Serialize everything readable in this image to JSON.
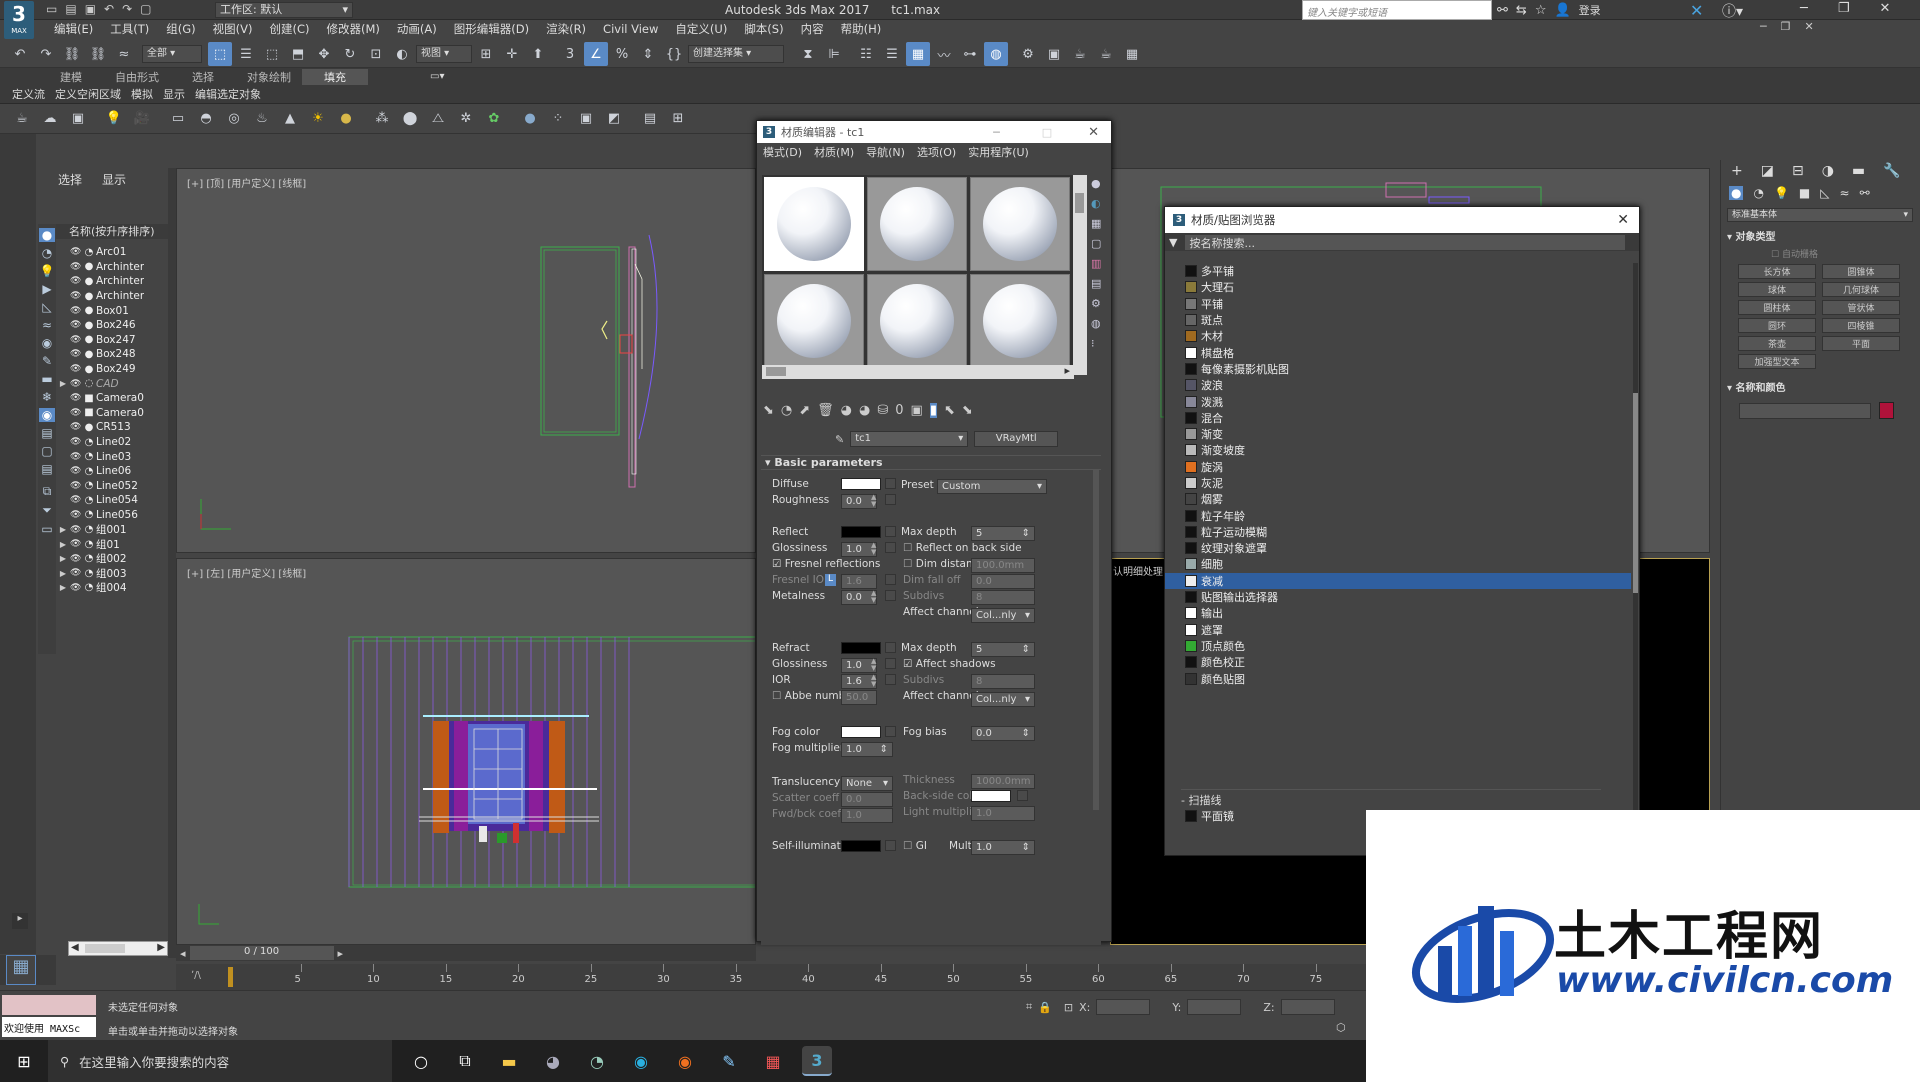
{
  "titlebar": {
    "app_logo": "3",
    "logo_sub": "MAX",
    "workspace_label": "工作区: 默认",
    "title": "Autodesk 3ds Max 2017",
    "file": "tc1.max",
    "search_placeholder": "键入关键字或短语",
    "login": "登录"
  },
  "menu": [
    "编辑(E)",
    "工具(T)",
    "组(G)",
    "视图(V)",
    "创建(C)",
    "修改器(M)",
    "动画(A)",
    "图形编辑器(D)",
    "渲染(R)",
    "Civil View",
    "自定义(U)",
    "脚本(S)",
    "内容",
    "帮助(H)"
  ],
  "toolbar": {
    "filter": "全部",
    "view": "视图",
    "selection_set": "创建选择集"
  },
  "ribbon_tabs": [
    "建模",
    "自由形式",
    "选择",
    "对象绘制",
    "填充"
  ],
  "ribbon_sub": [
    "定义流",
    "定义空闲区域",
    "模拟",
    "显示",
    "编辑选定对象"
  ],
  "scene_explorer": {
    "tabs": [
      "选择",
      "显示"
    ],
    "header": "名称(按升序排序)",
    "items": [
      {
        "name": "Arc01",
        "type": "shape"
      },
      {
        "name": "Archinter",
        "type": "geo"
      },
      {
        "name": "Archinter",
        "type": "geo"
      },
      {
        "name": "Archinter",
        "type": "geo"
      },
      {
        "name": "Box01",
        "type": "geo"
      },
      {
        "name": "Box246",
        "type": "geo"
      },
      {
        "name": "Box247",
        "type": "geo"
      },
      {
        "name": "Box248",
        "type": "geo"
      },
      {
        "name": "Box249",
        "type": "geo"
      },
      {
        "name": "CAD",
        "type": "layer",
        "italic": true,
        "expand": true
      },
      {
        "name": "Camera0",
        "type": "camera"
      },
      {
        "name": "Camera0",
        "type": "camera"
      },
      {
        "name": "CR513",
        "type": "geo"
      },
      {
        "name": "Line02",
        "type": "shape"
      },
      {
        "name": "Line03",
        "type": "shape"
      },
      {
        "name": "Line06",
        "type": "shape"
      },
      {
        "name": "Line052",
        "type": "shape"
      },
      {
        "name": "Line054",
        "type": "shape"
      },
      {
        "name": "Line056",
        "type": "shape"
      },
      {
        "name": "组001",
        "type": "group",
        "expand": true
      },
      {
        "name": "组01",
        "type": "group",
        "expand": true
      },
      {
        "name": "组002",
        "type": "group",
        "expand": true
      },
      {
        "name": "组003",
        "type": "group",
        "expand": true
      },
      {
        "name": "组004",
        "type": "group",
        "expand": true
      }
    ]
  },
  "viewports": {
    "top": "[+] [顶] [用户定义] [线框]",
    "left": "[+] [左] [用户定义] [线框]"
  },
  "material_editor": {
    "title": "材质编辑器 - tc1",
    "menu": [
      "模式(D)",
      "材质(M)",
      "导航(N)",
      "选项(O)",
      "实用程序(U)"
    ],
    "mat_name": "tc1",
    "mat_type": "VRayMtl",
    "section": "Basic parameters",
    "diffuse": "Diffuse",
    "roughness": "Roughness",
    "roughness_val": "0.0",
    "preset": "Preset",
    "preset_val": "Custom",
    "reflect": "Reflect",
    "glossiness": "Glossiness",
    "gloss_val": "1.0",
    "max_depth": "Max depth",
    "max_depth_val": "5",
    "reflect_back": "Reflect on back side",
    "fresnel": "Fresnel reflections",
    "dim_distance": "Dim distance",
    "dim_distance_val": "100.0mm",
    "fresnel_ior": "Fresnel IOR",
    "fresnel_l": "L",
    "fresnel_ior_val": "1.6",
    "dim_falloff": "Dim fall off",
    "dim_falloff_val": "0.0",
    "metalness": "Metalness",
    "metal_val": "0.0",
    "subdivs": "Subdivs",
    "subdivs_val": "8",
    "affect_channels": "Affect channels",
    "channels_val": "Col...nly",
    "refract": "Refract",
    "r_gloss_val": "1.0",
    "r_max_depth_val": "5",
    "affect_shadows": "Affect shadows",
    "ior": "IOR",
    "ior_val": "1.6",
    "abbe": "Abbe number",
    "abbe_val": "50.0",
    "fog_color": "Fog color",
    "fog_bias": "Fog bias",
    "fog_bias_val": "0.0",
    "fog_mult": "Fog multiplier",
    "fog_mult_val": "1.0",
    "translucency": "Translucency",
    "transl_val": "None",
    "thickness": "Thickness",
    "thickness_val": "1000.0mm",
    "scatter": "Scatter coeff",
    "scatter_val": "0.0",
    "backside": "Back-side color",
    "fwd": "Fwd/bck coeff",
    "fwd_val": "1.0",
    "light_mult": "Light multiplier",
    "light_mult_val": "1.0",
    "selfillum": "Self-illumination",
    "gi": "GI",
    "mult": "Mult",
    "mult_val": "1.0"
  },
  "map_browser": {
    "title": "材质/贴图浏览器",
    "search": "按名称搜索...",
    "items": [
      {
        "name": "多平铺",
        "c": "#111"
      },
      {
        "name": "大理石",
        "c": "#8a7a3a"
      },
      {
        "name": "平铺",
        "c": "#777"
      },
      {
        "name": "斑点",
        "c": "#666"
      },
      {
        "name": "木材",
        "c": "#a06a20"
      },
      {
        "name": "棋盘格",
        "c": "#fff"
      },
      {
        "name": "每像素摄影机贴图",
        "c": "#111"
      },
      {
        "name": "波浪",
        "c": "#556"
      },
      {
        "name": "泼溅",
        "c": "#889"
      },
      {
        "name": "混合",
        "c": "#111"
      },
      {
        "name": "渐变",
        "c": "#999"
      },
      {
        "name": "渐变坡度",
        "c": "#bbb"
      },
      {
        "name": "旋涡",
        "c": "#e07020"
      },
      {
        "name": "灰泥",
        "c": "#ccc"
      },
      {
        "name": "烟雾",
        "c": "#444"
      },
      {
        "name": "粒子年龄",
        "c": "#111"
      },
      {
        "name": "粒子运动模糊",
        "c": "#111"
      },
      {
        "name": "纹理对象遮罩",
        "c": "#111"
      },
      {
        "name": "细胞",
        "c": "#9aa"
      },
      {
        "name": "衰减",
        "c": "#eee",
        "selected": true
      },
      {
        "name": "贴图输出选择器",
        "c": "#111"
      },
      {
        "name": "输出",
        "c": "#fff"
      },
      {
        "name": "遮罩",
        "c": "#fff"
      },
      {
        "name": "顶点颜色",
        "c": "#3a3"
      },
      {
        "name": "颜色校正",
        "c": "#111"
      },
      {
        "name": "颜色贴图",
        "c": "#333"
      }
    ],
    "group": "扫描线",
    "after": "平面镜"
  },
  "behind_text": "认明细处理",
  "command_panel": {
    "dropdown": "标准基本体",
    "rollout1": "对象类型",
    "autogrid": "自动栅格",
    "buttons": [
      "长方体",
      "圆锥体",
      "球体",
      "几何球体",
      "圆柱体",
      "管状体",
      "圆环",
      "四棱锥",
      "茶壶",
      "平面",
      "加强型文本"
    ],
    "rollout2": "名称和颜色",
    "obj_color": "#b0123a"
  },
  "timeline": {
    "frame": "0 / 100",
    "ticks": [
      "5",
      "10",
      "15",
      "20",
      "25",
      "30",
      "35",
      "40",
      "45",
      "50",
      "55",
      "60",
      "65",
      "70",
      "75"
    ]
  },
  "status": {
    "maxscript": "欢迎使用 MAXSc",
    "line1": "未选定任何对象",
    "line2": "单击或单击并拖动以选择对象",
    "x": "X:",
    "y": "Y:",
    "z": "Z:"
  },
  "taskbar": {
    "search": "在这里输入你要搜索的内容"
  },
  "watermark": {
    "brand": "土木工程网",
    "url": "www.civilcn.com"
  }
}
